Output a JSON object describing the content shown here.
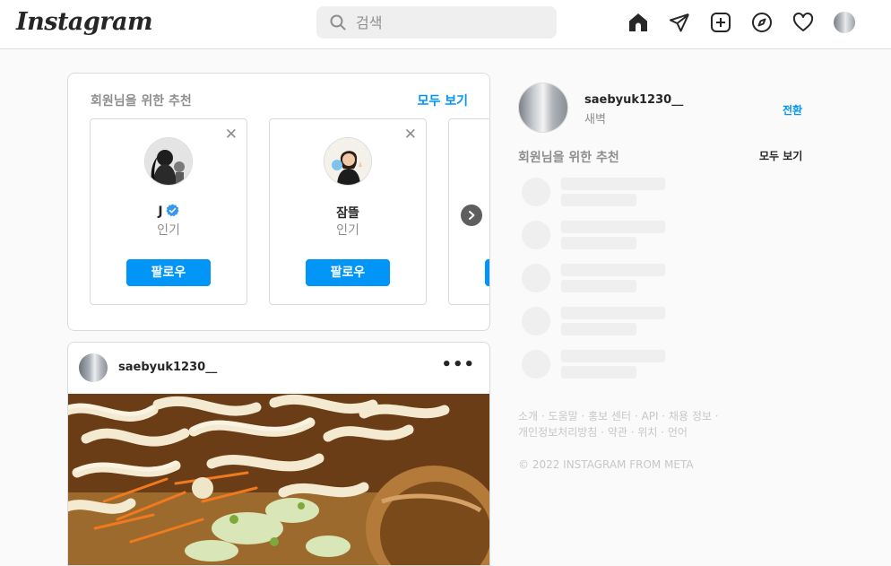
{
  "header": {
    "logo_text": "Instagram",
    "search_placeholder": "검색",
    "icons": [
      "home-icon",
      "direct-message-icon",
      "new-post-icon",
      "explore-icon",
      "activity-heart-icon",
      "profile-avatar"
    ]
  },
  "suggestions": {
    "title": "회원님을 위한 추천",
    "see_all": "모두 보기",
    "cards": [
      {
        "name": "J",
        "verified": true,
        "subtitle": "인기",
        "follow_label": "팔로우",
        "close": "✕"
      },
      {
        "name": "잠뜰",
        "verified": false,
        "subtitle": "인기",
        "follow_label": "팔로우",
        "close": "✕"
      }
    ]
  },
  "post": {
    "username": "saebyuk1230__",
    "more": "•••"
  },
  "sidebar": {
    "username": "saebyuk1230__",
    "name": "새벽",
    "switch_label": "전환",
    "suggest_title": "회원님을 위한 추천",
    "see_all": "모두 보기"
  },
  "footer": {
    "links": [
      "소개",
      "도움말",
      "홍보 센터",
      "API",
      "채용 정보",
      "개인정보처리방침",
      "약관",
      "위치",
      "언어"
    ],
    "copyright": "© 2022 INSTAGRAM FROM META"
  },
  "colors": {
    "accent": "#0095f6",
    "border": "#dbdbdb",
    "muted": "#8e8e8e",
    "skeleton": "#efefef"
  }
}
